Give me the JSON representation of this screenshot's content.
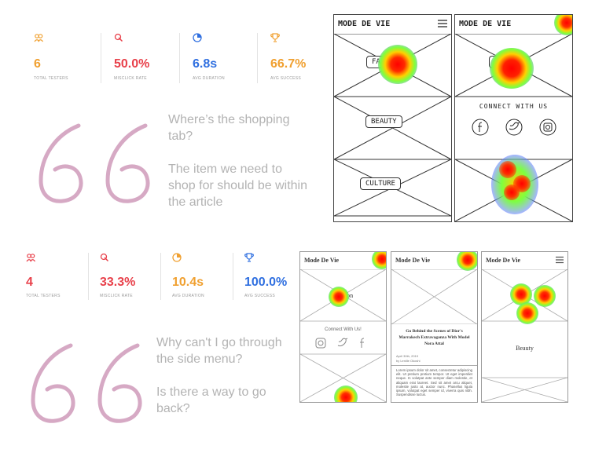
{
  "study1": {
    "stats": [
      {
        "value": "6",
        "label": "TOTAL TESTERS",
        "icon": "testers-icon",
        "color": "#f0a030"
      },
      {
        "value": "50.0%",
        "label": "MISCLICK RATE",
        "icon": "misclick-icon",
        "color": "#e8404a"
      },
      {
        "value": "6.8s",
        "label": "AVG DURATION",
        "icon": "duration-icon",
        "color": "#2f6fe0"
      },
      {
        "value": "66.7%",
        "label": "AVG SUCCESS",
        "icon": "success-icon",
        "color": "#f0a030"
      }
    ],
    "quotes": [
      "Where’s the shopping tab?",
      "The item we need to shop for should be within the article"
    ],
    "screens": [
      {
        "title": "MODE DE VIE",
        "tiles": [
          "FASHION",
          "BEAUTY",
          "CULTURE"
        ]
      },
      {
        "title": "MODE DE VIE",
        "tiles": [
          "FASHION"
        ],
        "connect": "CONNECT WITH US"
      }
    ]
  },
  "study2": {
    "stats": [
      {
        "value": "4",
        "label": "TOTAL TESTERS",
        "icon": "testers-icon",
        "color": "#e8404a"
      },
      {
        "value": "33.3%",
        "label": "MISCLICK RATE",
        "icon": "misclick-icon",
        "color": "#e8404a"
      },
      {
        "value": "10.4s",
        "label": "AVG DURATION",
        "icon": "duration-icon",
        "color": "#f0a030"
      },
      {
        "value": "100.0%",
        "label": "AVG SUCCESS",
        "icon": "success-icon",
        "color": "#2f6fe0"
      }
    ],
    "quotes": [
      "Why can't I go through the side menu?",
      "Is there a way to go back?"
    ],
    "screens": [
      {
        "title": "Mode De Vie",
        "tile": "Fashion",
        "connect": "Connect With Us!"
      },
      {
        "title": "Mode De Vie",
        "article_title": "Go Behind the Scenes of Dior's Marrakech Extravaganza With Model Nora Attal",
        "date": "April 30th, 2019",
        "author": "by Lenille Okoshi",
        "body": "Lorem ipsum dolor sit amet, consectetur adipiscing elit. Ut pretium pretium tempor. Ut eget imperdiet neque. In volutpat ante semper diam molestie, et aliquam erat laoreet. Sed sit amet arcu aliquet, molestie justo at, auctor nunc. Phasellus ligula ipsum, volutpat eget semper id, viverra quis nibh. Suspendisse luctus."
      },
      {
        "title": "Mode De Vie",
        "tiles": [
          "",
          "Beauty"
        ]
      }
    ]
  },
  "colors": {
    "quote_mark": "#d6a9c4",
    "quote_text": "#b3b3b3"
  }
}
